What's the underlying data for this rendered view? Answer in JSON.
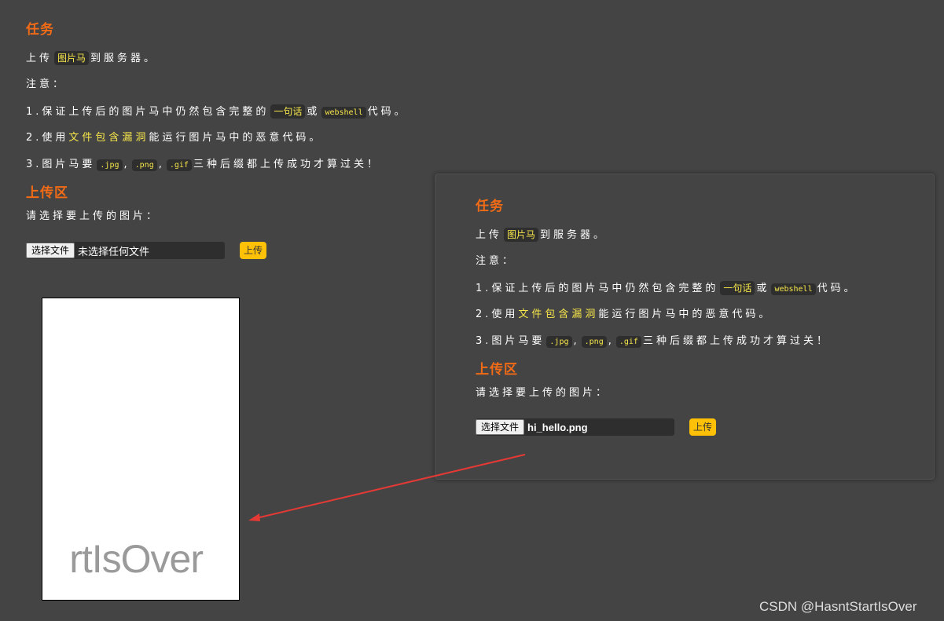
{
  "left": {
    "task_heading": "任务",
    "task_line_prefix": "上传",
    "task_code": "图片马",
    "task_line_suffix": "到服务器。",
    "note": "注意：",
    "rule1_prefix": "1.保证上传后的图片马中仍然包含完整的",
    "rule1_code1": "一句话",
    "rule1_mid": "或",
    "rule1_code2": "webshell",
    "rule1_suffix": "代码。",
    "rule2_prefix": "2.使用",
    "rule2_highlight": "文件包含漏洞",
    "rule2_suffix": "能运行图片马中的恶意代码。",
    "rule3_prefix": "3.图片马要",
    "rule3_ext1": ".jpg",
    "rule3_ext2": ".png",
    "rule3_ext3": ".gif",
    "rule3_sep": ",",
    "rule3_suffix": "三种后缀都上传成功才算过关！",
    "upload_heading": "上传区",
    "upload_prompt": "请选择要上传的图片：",
    "choose_file_label": "选择文件",
    "file_status": "未选择任何文件",
    "upload_label": "上传"
  },
  "right": {
    "task_heading": "任务",
    "task_line_prefix": "上传",
    "task_code": "图片马",
    "task_line_suffix": "到服务器。",
    "note": "注意：",
    "rule1_prefix": "1.保证上传后的图片马中仍然包含完整的",
    "rule1_code1": "一句话",
    "rule1_mid": "或",
    "rule1_code2": "webshell",
    "rule1_suffix": "代码。",
    "rule2_prefix": "2.使用",
    "rule2_highlight": "文件包含漏洞",
    "rule2_suffix": "能运行图片马中的恶意代码。",
    "rule3_prefix": "3.图片马要",
    "rule3_ext1": ".jpg",
    "rule3_ext2": ".png",
    "rule3_ext3": ".gif",
    "rule3_sep": ",",
    "rule3_suffix": "三种后缀都上传成功才算过关！",
    "upload_heading": "上传区",
    "upload_prompt": "请选择要上传的图片：",
    "choose_file_label": "选择文件",
    "file_status": "hi_hello.png",
    "upload_label": "上传"
  },
  "preview": {
    "image_text": "rtIsOver"
  },
  "watermark": "CSDN @HasntStartIsOver",
  "colors": {
    "background": "#444444",
    "heading": "#f26b16",
    "highlight": "#f7e64a",
    "upload_button": "#ffc107",
    "arrow": "#e53935"
  }
}
